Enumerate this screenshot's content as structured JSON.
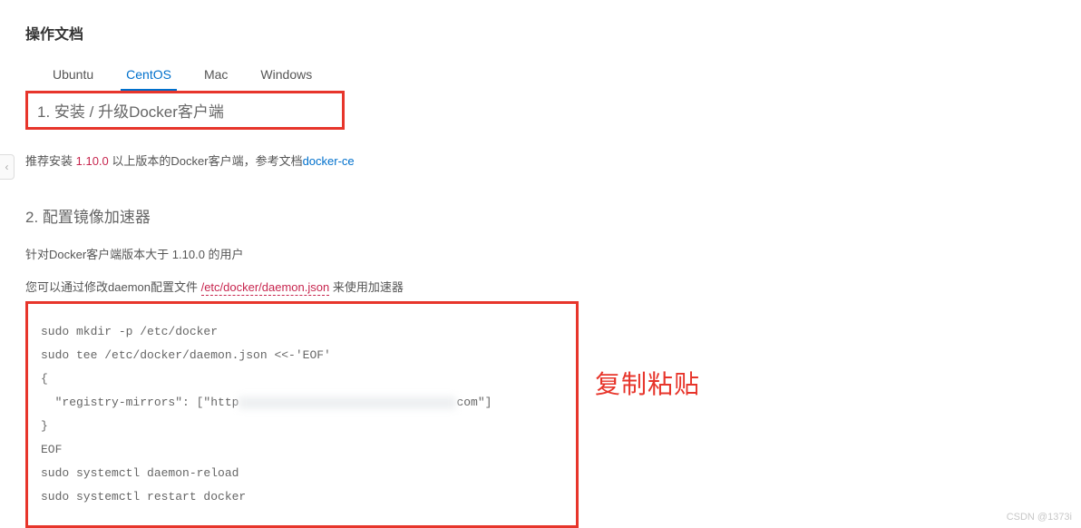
{
  "page": {
    "title": "操作文档"
  },
  "tabs": {
    "items": [
      {
        "label": "Ubuntu"
      },
      {
        "label": "CentOS"
      },
      {
        "label": "Mac"
      },
      {
        "label": "Windows"
      }
    ],
    "activeIndex": 1
  },
  "section1": {
    "heading": "1. 安装 / 升级Docker客户端",
    "para_prefix": "推荐安装 ",
    "version": "1.10.0",
    "para_mid": " 以上版本的Docker客户端，参考文档",
    "link_text": "docker-ce"
  },
  "section2": {
    "heading": "2. 配置镜像加速器",
    "para1": "针对Docker客户端版本大于 1.10.0 的用户",
    "para2_prefix": "您可以通过修改daemon配置文件 ",
    "daemon_path": "/etc/docker/daemon.json",
    "para2_suffix": " 来使用加速器"
  },
  "code": {
    "line1": "sudo mkdir -p /etc/docker",
    "line2": "sudo tee /etc/docker/daemon.json <<-'EOF'",
    "line3": "{",
    "line4_prefix": "  \"registry-mirrors\": [\"http",
    "line4_suffix": "com\"]",
    "line5": "}",
    "line6": "EOF",
    "line7": "sudo systemctl daemon-reload",
    "line8": "sudo systemctl restart docker"
  },
  "annotation": {
    "copy_label": "复制粘贴"
  },
  "side_tab_glyph": "‹",
  "watermark": "CSDN @1373i"
}
